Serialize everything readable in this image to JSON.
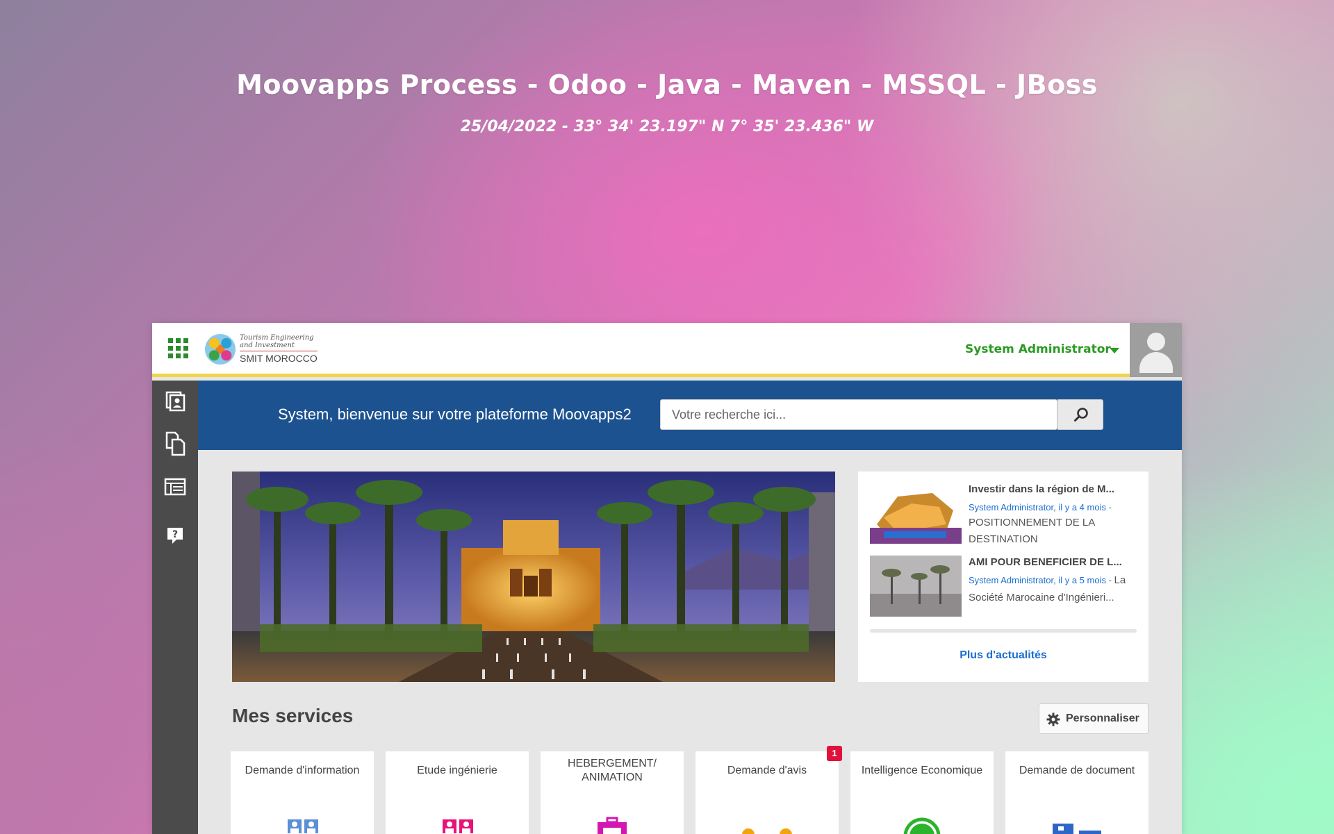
{
  "headline": "Moovapps Process   -   Odoo   -   Java   -   Maven   -   MSSQL   -   JBoss",
  "subline": "25/04/2022 - 33° 34' 23.197\" N 7° 35' 23.436\" W",
  "app": {
    "logo": {
      "line1": "Tourism Engineering and Investment",
      "line2": "SMIT MOROCCO"
    },
    "user": {
      "name": "System Administrator",
      "icon": "caret-down-icon",
      "avatar_icon": "user-avatar-icon"
    },
    "menu_icon": "apps-grid-icon",
    "sidebar": {
      "items": [
        {
          "icon": "contact-card-icon"
        },
        {
          "icon": "documents-icon"
        },
        {
          "icon": "list-table-icon"
        },
        {
          "icon": "help-bubble-icon"
        }
      ]
    },
    "banner": {
      "welcome": "System, bienvenue sur votre plateforme Moovapps2",
      "search_placeholder": "Votre recherche ici...",
      "search_icon": "search-icon"
    },
    "news": {
      "items": [
        {
          "title": "Investir dans la région de M...",
          "meta": "System Administrator, il y a 4 mois -",
          "body": "POSITIONNEMENT DE LA DESTINATION"
        },
        {
          "title": "AMI POUR BENEFICIER DE L...",
          "meta": "System Administrator, il y a 5 mois -",
          "meta_tail": "La",
          "body": "Société Marocaine d'Ingénieri..."
        }
      ],
      "more_label": "Plus d'actualités"
    },
    "services": {
      "title": "Mes services",
      "customize_label": "Personnaliser",
      "customize_icon": "gear-icon",
      "tiles": [
        {
          "label": "Demande d'information",
          "icon": "people-icon",
          "color": "#5b8fd6"
        },
        {
          "label": "Etude ingénierie",
          "icon": "people-icon",
          "color": "#e8137a"
        },
        {
          "label": "HEBERGEMENT/ ANIMATION",
          "icon": "suitcase-icon",
          "color": "#d516b2"
        },
        {
          "label": "Demande d'avis",
          "icon": "dots-icon",
          "color": "#f2a40c",
          "badge": "1"
        },
        {
          "label": "Intelligence Economique",
          "icon": "globe-icon",
          "color": "#2bb32b"
        },
        {
          "label": "Demande de document",
          "icon": "document-icon",
          "color": "#2d66c8"
        }
      ]
    }
  }
}
